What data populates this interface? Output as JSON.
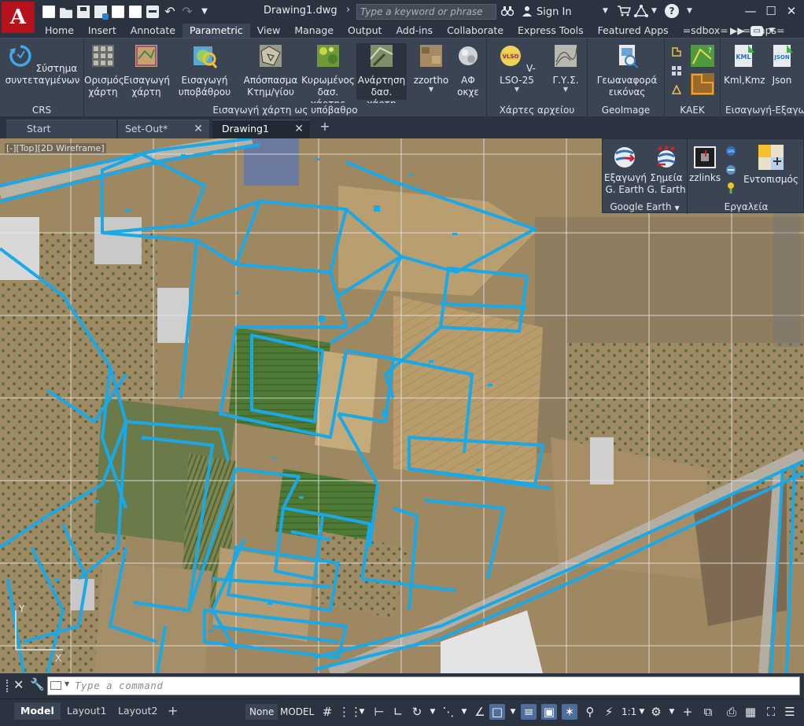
{
  "app": {
    "logo_letter": "A",
    "document_title": "Drawing1.dwg"
  },
  "titlebar": {
    "search_placeholder": "Type a keyword or phrase",
    "sign_in": "Sign In",
    "help": "?"
  },
  "ribbon_tabs": [
    "Home",
    "Insert",
    "Annotate",
    "Parametric",
    "View",
    "Manage",
    "Output",
    "Add-ins",
    "Collaborate",
    "Express Tools",
    "Featured Apps",
    "=sdbox=",
    "=Maps="
  ],
  "ribbon_active_tab": "Parametric",
  "ribbon": {
    "crs": {
      "btn1": "Σύστημα",
      "btn2": "συντεταγμένων",
      "title": "CRS"
    },
    "map": {
      "b1a": "Ορισμός",
      "b1b": "χάρτη",
      "b2a": "Εισαγωγή",
      "b2b": "χάρτη",
      "b3a": "Εισαγωγή",
      "b3b": "υποβάθρου",
      "b4a": "Απόσπασμα",
      "b4b": "Κτημ/γίου",
      "b5a": "Κυρωμένος",
      "b5b": "δασ. χάρτης",
      "b6a": "Ανάρτηση",
      "b6b": "δασ. χάρτη",
      "b7": "zzortho",
      "b8a": "ΑΦ",
      "b8b": "οκχε",
      "title": "Εισαγωγή χάρτη ως υπόβαθρο"
    },
    "archive": {
      "b1": "V-LSO-25",
      "b2": "Γ.Υ.Σ.",
      "title": "Χάρτες αρχείου"
    },
    "geoimage": {
      "b1a": "Γεωαναφορά",
      "b1b": "εικόνας",
      "title": "GeoImage"
    },
    "kaek": {
      "title": "ΚΑΕΚ"
    },
    "export": {
      "b1": "Kml,Kmz",
      "b2": "Json",
      "title": "Εισαγωγή-Εξαγωγή"
    }
  },
  "doc_tabs": [
    {
      "label": "Start"
    },
    {
      "label": "Set-Out*"
    },
    {
      "label": "Drawing1"
    }
  ],
  "viewport": {
    "view_label": "[-][Top][2D Wireframe]"
  },
  "palette": {
    "ge_export_a": "Εξαγωγή",
    "ge_export_b": "G. Earth",
    "ge_points_a": "Σημεία",
    "ge_points_b": "G. Earth",
    "google_earth_title": "Google Earth",
    "zzlinks": "zzlinks",
    "locate": "Εντοπισμός",
    "tools_title": "Εργαλεία"
  },
  "command": {
    "placeholder": "Type a command"
  },
  "status": {
    "layout_tabs": [
      "Model",
      "Layout1",
      "Layout2"
    ],
    "none": "None",
    "model": "MODEL",
    "scale": "1:1"
  },
  "colors": {
    "parcel_line": "#1aa9e6",
    "logo_red": "#b5121b",
    "ui_dark": "#2b3340",
    "ui_panel": "#3b4453"
  }
}
